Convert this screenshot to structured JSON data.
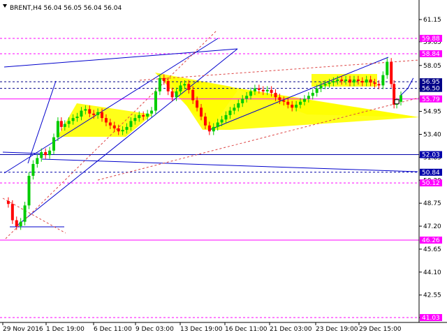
{
  "header": {
    "text": "BRENT,H4  56.04 56.05 56.04 56.04"
  },
  "colors": {
    "candle_up": "#00cc00",
    "candle_down": "#ff0000",
    "triangle_fill": "#ffff00",
    "channel_blue": "#0000cc",
    "level_magenta": "#ff00ff",
    "level_blue": "#0000aa",
    "trend_red": "#dd4444"
  },
  "chart_data": {
    "type": "line",
    "title": "",
    "instrument": "BRENT",
    "timeframe": "H4",
    "ylim": [
      40.77,
      62.11
    ],
    "y_ticks": [
      "61.15",
      "59.65",
      "58.05",
      "56.50",
      "54.95",
      "53.40",
      "51.85",
      "50.30",
      "48.75",
      "47.20",
      "45.65",
      "44.10",
      "42.55",
      "41.03"
    ],
    "x_ticks": [
      "29 Nov 2016",
      "1 Dec 19:00",
      "6 Dec 11:00",
      "9 Dec 03:00",
      "13 Dec 19:00",
      "16 Dec 11:00",
      "21 Dec 03:00",
      "23 Dec 19:00",
      "29 Dec 15:00"
    ],
    "price_levels": [
      {
        "label": "59.88",
        "value": 59.88,
        "color": "#ff00ff",
        "style": "dashed"
      },
      {
        "label": "58.84",
        "value": 58.84,
        "color": "#ff00ff",
        "style": "dashed"
      },
      {
        "label": "56.95",
        "value": 56.95,
        "color": "#000088",
        "style": "dashed"
      },
      {
        "label": "56.50",
        "value": 56.5,
        "color": "#000088",
        "style": "dashed"
      },
      {
        "label": "55.79",
        "value": 55.79,
        "color": "#ff00ff",
        "style": "solid"
      },
      {
        "label": "52.03",
        "value": 52.03,
        "color": "#0000aa",
        "style": "solid"
      },
      {
        "label": "50.84",
        "value": 50.84,
        "color": "#0000aa",
        "style": "dashed"
      },
      {
        "label": "50.12",
        "value": 50.12,
        "color": "#ff00ff",
        "style": "dashed"
      },
      {
        "label": "46.26",
        "value": 46.26,
        "color": "#ff00ff",
        "style": "solid"
      },
      {
        "label": "41.03",
        "value": 41.03,
        "color": "#ff00ff",
        "style": "dashed"
      }
    ],
    "price_path": [
      [
        0,
        48.9
      ],
      [
        0.6,
        48.7
      ],
      [
        1.2,
        47.6
      ],
      [
        1.8,
        47.2
      ],
      [
        2.4,
        47.5
      ],
      [
        3.0,
        48.6
      ],
      [
        3.6,
        50.6
      ],
      [
        4.2,
        51.4
      ],
      [
        4.8,
        51.8
      ],
      [
        5.4,
        52.2
      ],
      [
        6.0,
        52.0
      ],
      [
        6.6,
        52.3
      ],
      [
        7.2,
        53.2
      ],
      [
        7.8,
        54.3
      ],
      [
        8.3,
        53.9
      ],
      [
        8.8,
        54.1
      ],
      [
        9.4,
        54.3
      ],
      [
        10.0,
        54.5
      ],
      [
        10.6,
        54.6
      ],
      [
        11.2,
        55.0
      ],
      [
        11.8,
        55.1
      ],
      [
        12.4,
        54.8
      ],
      [
        13.0,
        54.7
      ],
      [
        13.6,
        54.9
      ],
      [
        14.2,
        54.5
      ],
      [
        14.8,
        54.2
      ],
      [
        15.4,
        54.0
      ],
      [
        16.0,
        53.8
      ],
      [
        16.6,
        53.6
      ],
      [
        17.2,
        53.7
      ],
      [
        17.8,
        53.9
      ],
      [
        18.4,
        54.3
      ],
      [
        19.0,
        54.5
      ],
      [
        19.6,
        54.7
      ],
      [
        20.2,
        54.6
      ],
      [
        20.8,
        54.8
      ],
      [
        21.4,
        55.0
      ],
      [
        22.0,
        56.3
      ],
      [
        22.6,
        57.2
      ],
      [
        23.2,
        57.0
      ],
      [
        23.8,
        56.3
      ],
      [
        24.4,
        55.9
      ],
      [
        25.0,
        56.3
      ],
      [
        25.6,
        56.7
      ],
      [
        26.2,
        56.8
      ],
      [
        26.8,
        56.4
      ],
      [
        27.4,
        55.7
      ],
      [
        28.0,
        55.2
      ],
      [
        28.6,
        54.6
      ],
      [
        29.2,
        54.0
      ],
      [
        29.8,
        53.6
      ],
      [
        30.4,
        53.9
      ],
      [
        31.0,
        54.2
      ],
      [
        31.6,
        54.4
      ],
      [
        32.2,
        54.7
      ],
      [
        32.8,
        55.0
      ],
      [
        33.4,
        55.2
      ],
      [
        34.0,
        55.5
      ],
      [
        34.6,
        55.8
      ],
      [
        35.2,
        56.0
      ],
      [
        35.8,
        56.3
      ],
      [
        36.4,
        56.5
      ],
      [
        37.0,
        56.4
      ],
      [
        37.6,
        56.3
      ],
      [
        38.2,
        56.4
      ],
      [
        38.8,
        56.2
      ],
      [
        39.4,
        55.9
      ],
      [
        40.0,
        55.7
      ],
      [
        40.6,
        55.6
      ],
      [
        41.2,
        55.4
      ],
      [
        41.8,
        55.2
      ],
      [
        42.4,
        55.4
      ],
      [
        43.0,
        55.6
      ],
      [
        43.6,
        55.8
      ],
      [
        44.2,
        56.0
      ],
      [
        44.8,
        56.2
      ],
      [
        45.4,
        56.5
      ],
      [
        46.0,
        56.7
      ],
      [
        46.6,
        56.8
      ],
      [
        47.2,
        56.9
      ],
      [
        47.8,
        57.0
      ],
      [
        48.4,
        57.1
      ],
      [
        49.0,
        57.0
      ],
      [
        49.6,
        57.1
      ],
      [
        50.2,
        56.9
      ],
      [
        50.8,
        57.1
      ],
      [
        51.4,
        57.0
      ],
      [
        52.0,
        56.9
      ],
      [
        52.6,
        57.1
      ],
      [
        53.2,
        56.9
      ],
      [
        53.8,
        56.8
      ],
      [
        54.4,
        56.7
      ],
      [
        55.0,
        57.4
      ],
      [
        55.6,
        58.3
      ],
      [
        56.2,
        56.8
      ],
      [
        56.6,
        55.4
      ],
      [
        57.0,
        55.6
      ],
      [
        57.6,
        56.04
      ]
    ],
    "projection": [
      [
        57.6,
        56.04
      ],
      [
        58.6,
        56.5
      ],
      [
        59.4,
        57.2
      ]
    ]
  }
}
